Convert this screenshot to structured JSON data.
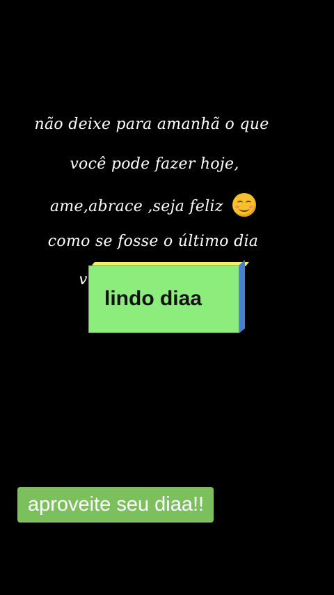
{
  "quote": {
    "line1": "não deixe para amanhã o que",
    "line2": "você pode fazer hoje,",
    "line3": "ame,abrace ,seja feliz",
    "line4": "como se fosse o último dia",
    "line5_partial": "v"
  },
  "emoji": {
    "name": "smiling-face-with-blush-icon",
    "color": "#f7c12e"
  },
  "card": {
    "label": "lindo diaa",
    "face_color": "#8ced7c",
    "top_color": "#f5ee6a",
    "side_color": "#4a7fd0"
  },
  "caption": {
    "text": "aproveite seu diaa!!",
    "background": "#7cc05e"
  },
  "background_color": "#000000"
}
